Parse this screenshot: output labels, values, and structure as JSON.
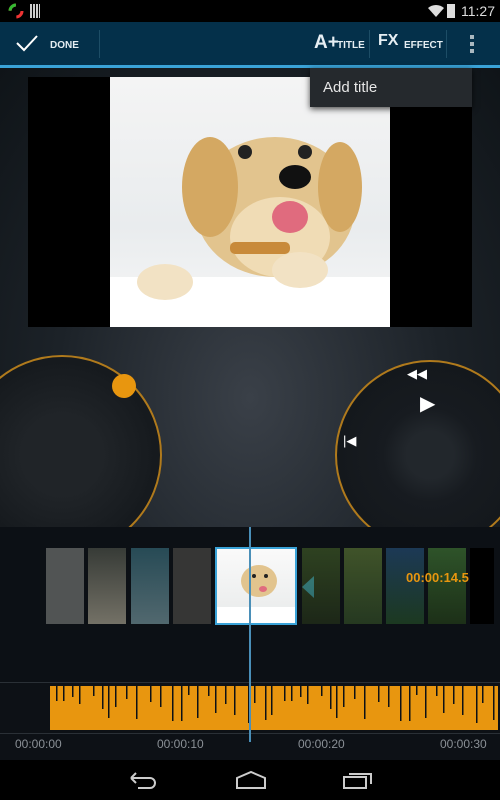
{
  "status_bar": {
    "time": "11:27"
  },
  "action_bar": {
    "done_label": "DONE",
    "title_label": "TITLE",
    "effect_label": "EFFECT",
    "title_icon": "A+",
    "effect_icon": "FX"
  },
  "overflow_menu": {
    "items": [
      {
        "label": "Add title"
      }
    ]
  },
  "timeline": {
    "current_time": "00:00:14.5",
    "time_labels": [
      "00:00:00",
      "00:00:10",
      "00:00:20",
      "00:00:30"
    ]
  },
  "colors": {
    "accent": "#3aa3d8",
    "orange": "#e8960f",
    "actionbar": "#04304a"
  }
}
